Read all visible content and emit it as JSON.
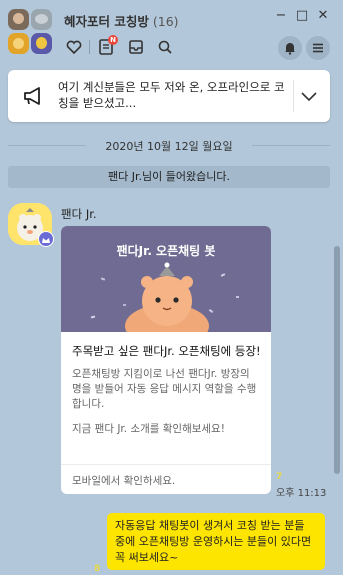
{
  "header": {
    "title": "혜자포터 코칭방",
    "member_count": "(16)",
    "window_controls": {
      "minimize": "−",
      "maximize": "□",
      "close": "✕"
    },
    "toolbar_badge": "N",
    "icons": [
      "heart-icon",
      "notes-icon",
      "inbox-icon",
      "search-icon",
      "bell-icon",
      "menu-icon"
    ]
  },
  "notice": {
    "text": "여기 계신분들은 모두 저와 온, 오프라인으로 코칭을 받으셨고..."
  },
  "chat": {
    "date_divider": "2020년 10월 12일 월요일",
    "system_message": "팬다 Jr.님이 들어왔습니다.",
    "incoming": {
      "sender": "팬다 Jr.",
      "card": {
        "hero_title": "팬다Jr. 오픈채팅 봇",
        "headline": "주목받고 싶은 팬다Jr. 오픈채팅에 등장!",
        "description": "오픈채팅방 지킴이로 나선 팬다Jr. 방장의 명을 받들어 자동 응답 메시지 역할을 수행합니다.",
        "cta": "지금 팬다 Jr. 소개를 확인해보세요!",
        "footer": "모바일에서 확인하세요."
      },
      "unread": "7",
      "time": "오후 11:13"
    },
    "outgoing": {
      "text": "자동응답 채팅봇이 생겨서 코칭 받는 분들 중에 오픈채팅방 운영하시는 분들이 있다면 꼭 써보세요~",
      "unread": "8"
    }
  },
  "colors": {
    "background": "#b2c7d9",
    "my_bubble": "#fee500",
    "card_hero": "#6f6b92",
    "unread": "#e8d94a"
  }
}
